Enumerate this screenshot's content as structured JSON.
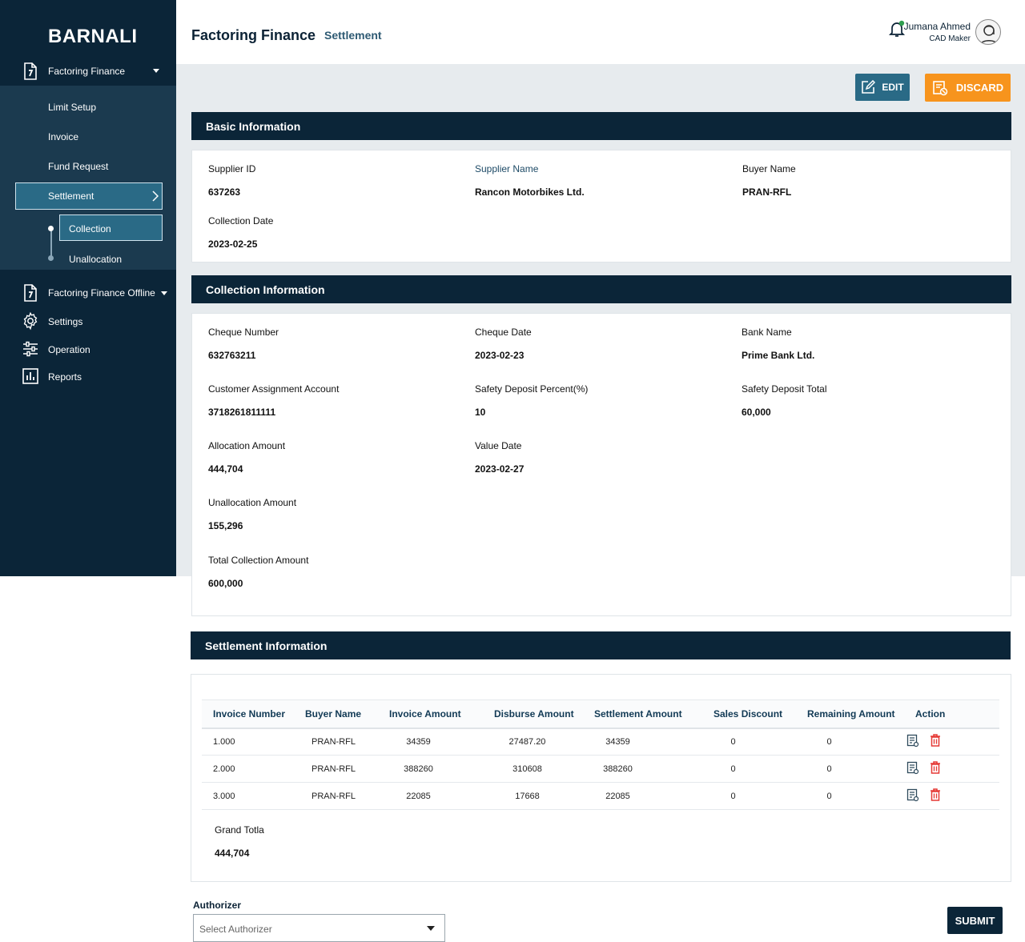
{
  "brand": "BARNALI",
  "sidebar": {
    "factoring_finance": "Factoring Finance",
    "sub_items": {
      "limit_setup": "Limit Setup",
      "invoice": "Invoice",
      "fund_request": "Fund Request",
      "settlement": "Settlement",
      "collection": "Collection",
      "unallocation": "Unallocation"
    },
    "factoring_finance_offline": "Factoring Finance Offline",
    "settings": "Settings",
    "operation": "Operation",
    "reports": "Reports"
  },
  "header": {
    "title": "Factoring Finance",
    "subtitle": "Settlement",
    "user_name": "Jumana Ahmed",
    "user_role": "CAD Maker"
  },
  "actions": {
    "edit": "EDIT",
    "discard": "DISCARD"
  },
  "basic": {
    "heading": "Basic Information",
    "supplier_id_label": "Supplier ID",
    "supplier_id": "637263",
    "supplier_name_label": "Supplier Name",
    "supplier_name": "Rancon Motorbikes Ltd.",
    "buyer_name_label": "Buyer Name",
    "buyer_name": "PRAN-RFL",
    "collection_date_label": "Collection Date",
    "collection_date": "2023-02-25"
  },
  "collection": {
    "heading": "Collection Information",
    "cheque_number_label": "Cheque Number",
    "cheque_number": "632763211",
    "cheque_date_label": "Cheque Date",
    "cheque_date": "2023-02-23",
    "bank_name_label": "Bank Name",
    "bank_name": "Prime Bank Ltd.",
    "cust_account_label": "Customer Assignment Account",
    "cust_account": "3718261811111",
    "sd_percent_label": "Safety Deposit Percent(%)",
    "sd_percent": "10",
    "sd_total_label": "Safety Deposit Total",
    "sd_total": "60,000",
    "allocation_label": "Allocation Amount",
    "allocation": "444,704",
    "value_date_label": "Value Date",
    "value_date": "2023-02-27",
    "unallocation_label": "Unallocation Amount",
    "unallocation": "155,296",
    "total_label": "Total Collection Amount",
    "total": "600,000"
  },
  "settlement": {
    "heading": "Settlement Information",
    "columns": [
      "Invoice Number",
      "Buyer Name",
      "Invoice Amount",
      "Disburse Amount",
      "Settlement Amount",
      "Sales Discount",
      "Remaining Amount",
      "Action"
    ],
    "rows": [
      [
        "1.000",
        "PRAN-RFL",
        "34359",
        "27487.20",
        "34359",
        "0",
        "0"
      ],
      [
        "2.000",
        "PRAN-RFL",
        "388260",
        "310608",
        "388260",
        "0",
        "0"
      ],
      [
        "3.000",
        "PRAN-RFL",
        "22085",
        "17668",
        "22085",
        "0",
        "0"
      ]
    ],
    "grand_total_label": "Grand Totla",
    "grand_total": "444,704"
  },
  "authorizer": {
    "label": "Authorizer",
    "placeholder": "Select Authorizer"
  },
  "submit": "SUBMIT",
  "colors": {
    "navy": "#0b2538",
    "teal": "#2a6a86",
    "orange": "#f7941d",
    "delete_red": "#e53935",
    "status_green": "#2e9e4f"
  }
}
